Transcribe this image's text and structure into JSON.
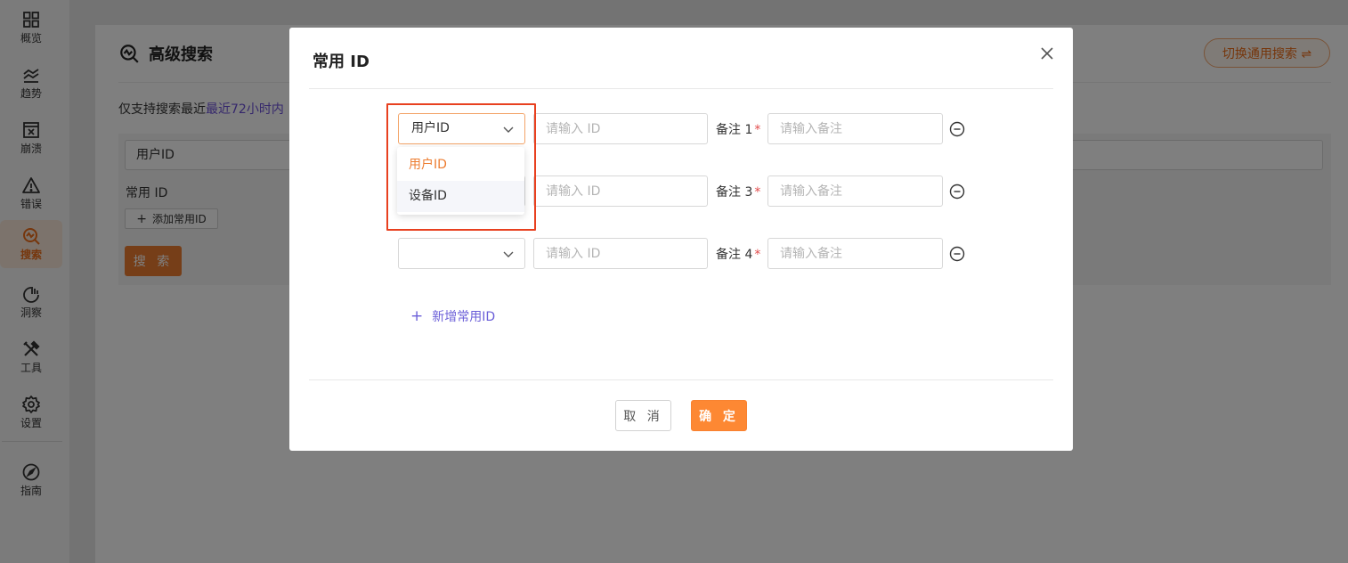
{
  "sidebar": {
    "items": [
      {
        "label": "概览",
        "icon": "dashboard-icon"
      },
      {
        "label": "趋势",
        "icon": "trend-icon"
      },
      {
        "label": "崩溃",
        "icon": "crash-icon"
      },
      {
        "label": "错误",
        "icon": "warning-icon"
      },
      {
        "label": "搜索",
        "icon": "search-analytics-icon",
        "active": true
      },
      {
        "label": "洞察",
        "icon": "insight-chart-icon"
      },
      {
        "label": "工具",
        "icon": "tools-icon"
      },
      {
        "label": "设置",
        "icon": "gear-icon"
      },
      {
        "label": "指南",
        "icon": "compass-icon"
      }
    ]
  },
  "page": {
    "title": "高级搜索",
    "switch_label": "切换通用搜索 ⇌",
    "tip_prefix": "仅支持搜索最近",
    "tip_highlight": "最近72小时内",
    "select_value": "用户ID",
    "common_id_label": "常用 ID",
    "add_common_label": "添加常用ID",
    "search_label": "搜 索"
  },
  "modal": {
    "title": "常用 ID",
    "rows": [
      {
        "type_value": "用户ID",
        "id_placeholder": "请输入 ID",
        "note_label": "备注 1",
        "note_placeholder": "请输入备注"
      },
      {
        "type_value": "",
        "id_placeholder": "请输入 ID",
        "note_label": "备注 3",
        "note_placeholder": "请输入备注"
      },
      {
        "type_value": "",
        "id_placeholder": "请输入 ID",
        "note_label": "备注 4",
        "note_placeholder": "请输入备注"
      }
    ],
    "required_mark": "*",
    "add_label": "新增常用ID",
    "cancel_label": "取 消",
    "ok_label": "确 定"
  },
  "dropdown": {
    "options": [
      {
        "label": "用户ID",
        "selected": true
      },
      {
        "label": "设备ID",
        "hovered": true
      }
    ]
  },
  "colors": {
    "accent": "#ed7d31",
    "link": "#6b5fd8",
    "highlight": "#e8401f"
  }
}
